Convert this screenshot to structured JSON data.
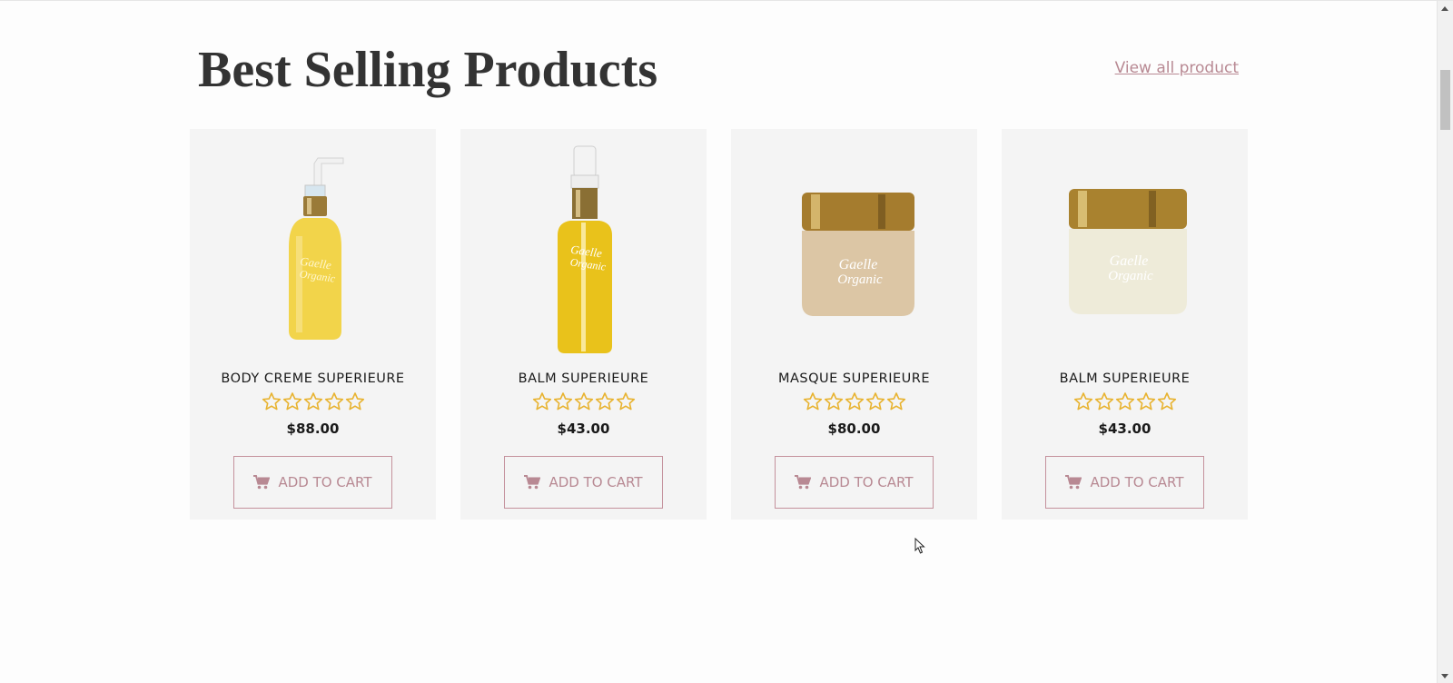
{
  "section": {
    "title": "Best Selling Products",
    "view_all_label": "View all product"
  },
  "products": [
    {
      "name": "BODY CREME SUPERIEURE",
      "price": "$88.00",
      "rating": 0,
      "image_icon": "yellow-pump-bottle",
      "add_label": "ADD TO CART"
    },
    {
      "name": "BALM SUPERIEURE",
      "price": "$43.00",
      "rating": 0,
      "image_icon": "oil-pump-bottle",
      "add_label": "ADD TO CART"
    },
    {
      "name": "MASQUE SUPERIEURE",
      "price": "$80.00",
      "rating": 0,
      "image_icon": "beige-cream-jar",
      "add_label": "ADD TO CART"
    },
    {
      "name": "BALM SUPERIEURE",
      "price": "$43.00",
      "rating": 0,
      "image_icon": "pearl-cream-jar",
      "add_label": "ADD TO CART"
    }
  ],
  "product_brand_text": {
    "line1": "Gaelle",
    "line2": "Organic"
  },
  "colors": {
    "accent": "#b88993",
    "button_border": "#c4919c",
    "star": "#e8b330",
    "card_bg": "#f4f4f4",
    "title": "#333333"
  }
}
